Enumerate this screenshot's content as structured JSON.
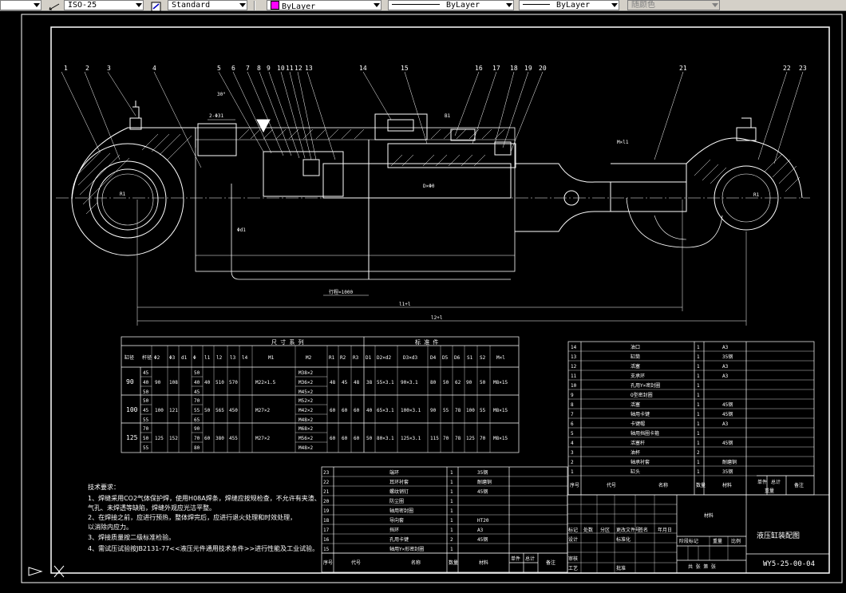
{
  "toolbar": {
    "dimstyle": "ISO-25",
    "textstyle": "Standard",
    "layer_color": "ByLayer",
    "linetype": "ByLayer",
    "lineweight": "ByLayer",
    "plotstyle": "随颜色",
    "colors": {
      "toolbar_bg": "#d4d0c8",
      "magenta": "#ff00ff",
      "canvas": "#000000",
      "lines": "#ffffff"
    }
  },
  "drawing": {
    "part_numbers": [
      "1",
      "2",
      "3",
      "4",
      "5",
      "6",
      "7",
      "8",
      "9",
      "10",
      "11",
      "12",
      "13",
      "14",
      "15",
      "16",
      "17",
      "18",
      "19",
      "20",
      "21",
      "22",
      "23"
    ],
    "dims": {
      "d_241": "2-Φ31",
      "angle": "30°",
      "stroke": "行程=1000",
      "l1": "l1+l",
      "l2": "l2+l",
      "m_x_l": "M×l1",
      "r_left": "R1",
      "r_right": "R1",
      "b_mark": "B1",
      "bore_a": "D×Φ0",
      "bore_b": "Φd1"
    }
  },
  "size_table": {
    "title_dim": "尺 寸 系 列",
    "title_std": "标 准 件",
    "headers": [
      "缸径",
      "杆径",
      "Φ2",
      "Φ3",
      "d1",
      "Φ",
      "l1",
      "l2",
      "l3",
      "l4",
      "M1",
      "M2",
      "R1",
      "R2",
      "R3",
      "D1",
      "D2×d2",
      "D3×d3",
      "D4",
      "D5",
      "D6",
      "S1",
      "S2",
      "M×l"
    ],
    "rows": [
      {
        "bore": "90",
        "rods": [
          "45",
          "40",
          "50"
        ],
        "c1": "90",
        "c2": "108",
        "d1": [
          "50",
          "40",
          "45"
        ],
        "c3": "40",
        "c4": "510",
        "c5": "570",
        "m1": "M22×1.5",
        "m2": [
          "M38×2",
          "M36×2",
          "M45×2"
        ],
        "r1": "48",
        "r2": "45",
        "r3": "48",
        "d": "38",
        "dd1": "55×3.1",
        "dd2": "90×3.1",
        "x1": "80",
        "x2": "50",
        "x3": "62",
        "x4": "90",
        "x5": "50",
        "mxl": "M8×15"
      },
      {
        "bore": "100",
        "rods": [
          "50",
          "45",
          "55"
        ],
        "c1": "100",
        "c2": "121",
        "d1": [
          "70",
          "55",
          "65"
        ],
        "c3": "50",
        "c4": "565",
        "c5": "450",
        "m1": "M27×2",
        "m2": [
          "M52×2",
          "M42×2",
          "M48×2"
        ],
        "r1": "60",
        "r2": "60",
        "r3": "60",
        "d": "40",
        "dd1": "65×3.1",
        "dd2": "100×3.1",
        "x1": "90",
        "x2": "55",
        "x3": "78",
        "x4": "100",
        "x5": "55",
        "mxl": "M8×15"
      },
      {
        "bore": "125",
        "rods": [
          "70",
          "50",
          "55"
        ],
        "c1": "125",
        "c2": "152",
        "d1": [
          "90",
          "70",
          "80"
        ],
        "c3": "60",
        "c4": "380",
        "c5": "455",
        "m1": "M27×2",
        "m2": [
          "M68×2",
          "M56×2",
          "M48×2"
        ],
        "r1": "60",
        "r2": "60",
        "r3": "60",
        "d": "50",
        "dd1": "80×3.1",
        "dd2": "125×3.1",
        "x1": "115",
        "x2": "70",
        "x3": "78",
        "x4": "125",
        "x5": "70",
        "mxl": "M8×15"
      }
    ]
  },
  "bom_upper": [
    {
      "no": "14",
      "name": "油口",
      "qty": "1",
      "mat": "A3"
    },
    {
      "no": "13",
      "name": "缸筒",
      "qty": "1",
      "mat": "35钢"
    },
    {
      "no": "12",
      "name": "活塞",
      "qty": "1",
      "mat": "A3"
    },
    {
      "no": "11",
      "name": "支承环",
      "qty": "1",
      "mat": "A3"
    },
    {
      "no": "10",
      "name": "孔用Y×密封圈",
      "qty": "1",
      "mat": ""
    },
    {
      "no": "9",
      "name": "O型密封圈",
      "qty": "1",
      "mat": ""
    },
    {
      "no": "8",
      "name": "活塞",
      "qty": "1",
      "mat": "45钢"
    },
    {
      "no": "7",
      "name": "轴用卡键",
      "qty": "1",
      "mat": "45钢"
    },
    {
      "no": "6",
      "name": "卡键帽",
      "qty": "1",
      "mat": "A3"
    },
    {
      "no": "5",
      "name": "轴用挡圈卡箍",
      "qty": "1",
      "mat": ""
    },
    {
      "no": "4",
      "name": "活塞杆",
      "qty": "1",
      "mat": "45钢"
    },
    {
      "no": "3",
      "name": "油杯",
      "qty": "2",
      "mat": ""
    },
    {
      "no": "2",
      "name": "轴承衬套",
      "qty": "1",
      "mat": "耐磨铜"
    },
    {
      "no": "1",
      "name": "缸头",
      "qty": "1",
      "mat": "35钢"
    }
  ],
  "bom_upper_header": {
    "no": "序号",
    "name": "代号",
    "name2": "名称",
    "qty": "数量",
    "mat": "材料",
    "c1": "单件",
    "c2": "总计",
    "weight": "重量",
    "note": "备注"
  },
  "bom_lower": [
    {
      "no": "23",
      "name": "端环",
      "qty": "1",
      "mat": "35钢"
    },
    {
      "no": "22",
      "name": "耳环衬套",
      "qty": "1",
      "mat": "耐磨铜"
    },
    {
      "no": "21",
      "name": "螺纹销钉",
      "qty": "1",
      "mat": "45钢"
    },
    {
      "no": "20",
      "name": "防尘圈",
      "qty": "1",
      "mat": ""
    },
    {
      "no": "19",
      "name": "轴用密封圈",
      "qty": "1",
      "mat": ""
    },
    {
      "no": "18",
      "name": "导向套",
      "qty": "1",
      "mat": "HT20"
    },
    {
      "no": "17",
      "name": "挡环",
      "qty": "1",
      "mat": "A3"
    },
    {
      "no": "16",
      "name": "孔用卡键",
      "qty": "2",
      "mat": "45钢"
    },
    {
      "no": "15",
      "name": "轴用Y×形密封圈",
      "qty": "1",
      "mat": ""
    }
  ],
  "bom_lower_header": {
    "no": "序号",
    "code": "代号",
    "name": "名称",
    "qty": "数量",
    "mat": "材料",
    "c1": "单件",
    "c2": "总计",
    "note": "备注"
  },
  "title_block": {
    "title": "液压缸装配图",
    "drawing_no": "WY5-25-00-04",
    "mark": "标记",
    "count": "处数",
    "zone": "分区",
    "change_no": "更改文件号",
    "sign": "签名",
    "date": "年月日",
    "design": "设计",
    "standard": "标准化",
    "review": "审核",
    "craft": "工艺",
    "approve": "批准",
    "stage": "阶段标记",
    "weight": "重量",
    "scale": "比例",
    "sheets": "共 张 第 张",
    "material": "材料"
  },
  "notes": {
    "title": "技术要求：",
    "lines": [
      "1、焊缝采用CO2气体保护焊，使用H08A焊条，焊缝应按规检查，不允许有夹渣、",
      "    气孔、未焊透等缺陷，焊缝外观应光洁平整。",
      "2、在焊接之前，应进行预热，整体焊完后，应进行退火处理和时效处理，",
      "    以消除内应力。",
      "3、焊接质量按二级标准检验。",
      "4、需试压试验按JB2131-77<<液压元件通用技术条件>>进行性能及工业试验。"
    ]
  }
}
